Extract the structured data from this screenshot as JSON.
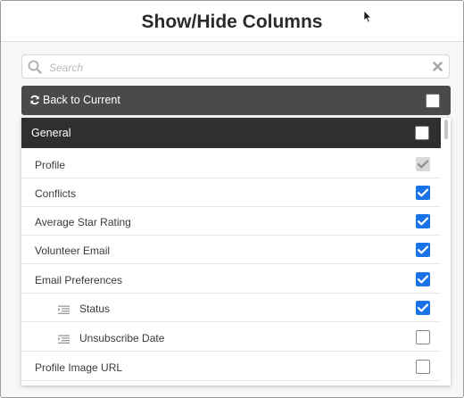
{
  "dialog": {
    "title": "Show/Hide Columns"
  },
  "search": {
    "placeholder": "Search",
    "value": ""
  },
  "back_to_current": {
    "label": "Back to Current",
    "checked": false
  },
  "group": {
    "label": "General",
    "checked": false
  },
  "rows": [
    {
      "label": "Profile",
      "state": "disabled-checked",
      "indent": false
    },
    {
      "label": "Conflicts",
      "state": "checked",
      "indent": false
    },
    {
      "label": "Average Star Rating",
      "state": "checked",
      "indent": false
    },
    {
      "label": "Volunteer Email",
      "state": "checked",
      "indent": false
    },
    {
      "label": "Email Preferences",
      "state": "checked",
      "indent": false
    },
    {
      "label": "Status",
      "state": "checked",
      "indent": true
    },
    {
      "label": "Unsubscribe Date",
      "state": "unchecked",
      "indent": true
    },
    {
      "label": "Profile Image URL",
      "state": "unchecked",
      "indent": false
    }
  ],
  "colors": {
    "accent": "#1a73e8",
    "dark_bar": "#4a4a4a",
    "group_bar": "#2f2f2f"
  }
}
